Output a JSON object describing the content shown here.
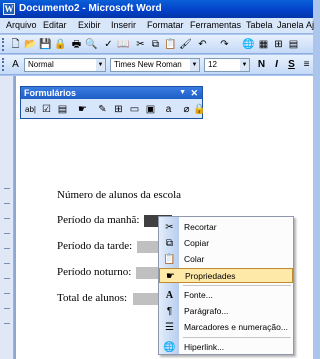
{
  "window": {
    "title": "Documento2 - Microsoft Word",
    "app_icon": "word-icon"
  },
  "menu": [
    "Arquivo",
    "Editar",
    "Exibir",
    "Inserir",
    "Formatar",
    "Ferramentas",
    "Tabela",
    "Janela",
    "Aj"
  ],
  "formatting": {
    "style": "Normal",
    "font": "Times New Roman",
    "size": "12",
    "bold": "N",
    "italic": "I",
    "underline": "S"
  },
  "forms_toolbar": {
    "title": "Formulários",
    "label_icon": "ab|"
  },
  "document": {
    "heading": "Número de alunos da escola",
    "lines": [
      "Período da manhã:",
      "Período da tarde:",
      "Período noturno:",
      "Total de alunos:"
    ]
  },
  "context_menu": {
    "items": [
      "Recortar",
      "Copiar",
      "Colar",
      "Propriedades",
      "Fonte...",
      "Parágrafo...",
      "Marcadores e numeração...",
      "Hiperlink..."
    ],
    "highlighted": "Propriedades"
  }
}
